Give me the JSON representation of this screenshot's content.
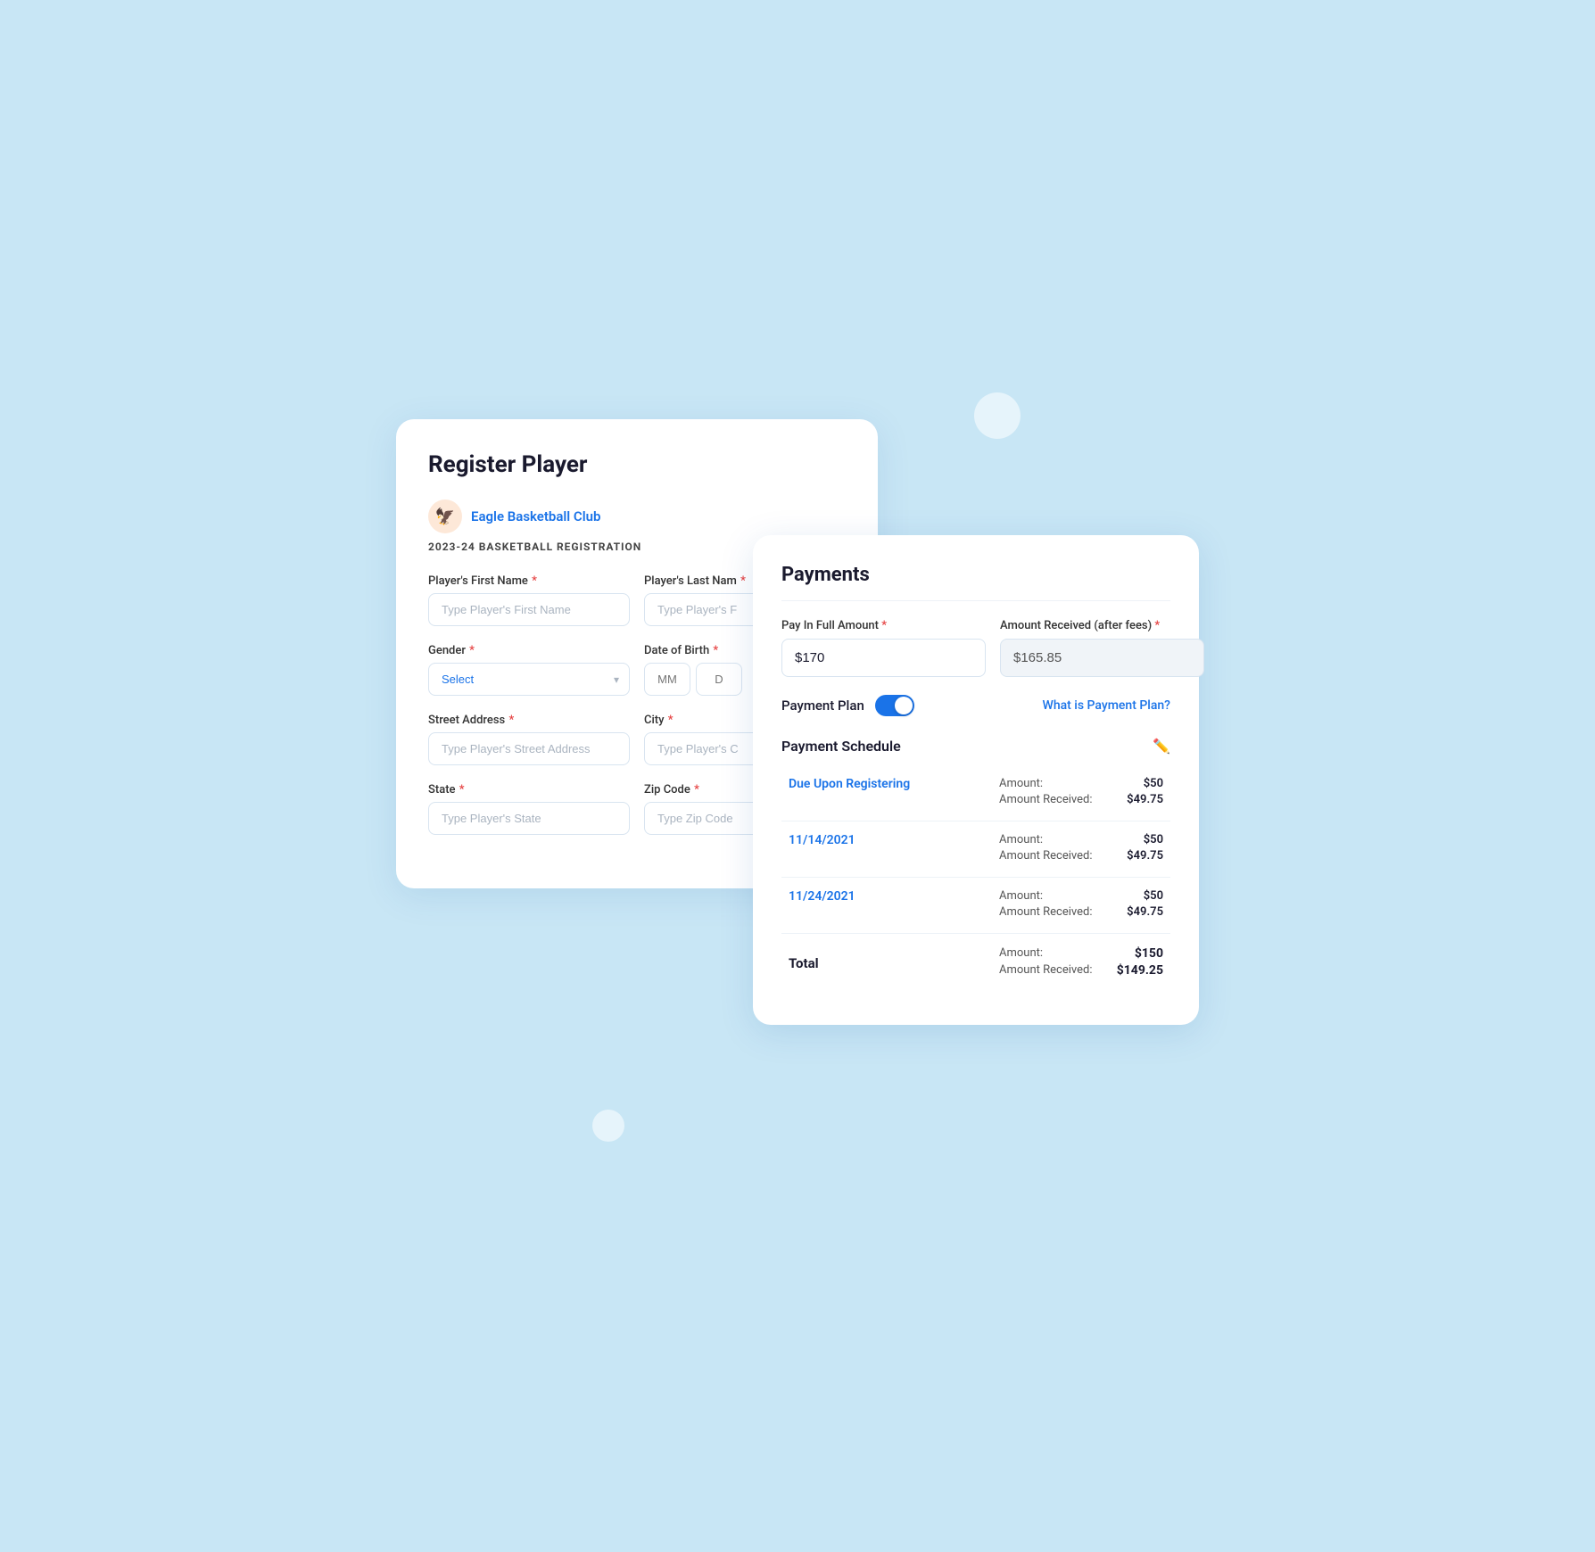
{
  "page": {
    "bg_color": "#c8e6f5"
  },
  "register_card": {
    "title": "Register Player",
    "club": {
      "name": "Eagle Basketball Club",
      "logo_emoji": "🦅"
    },
    "season": "2023-24 BASKETBALL REGISTRATION",
    "fields": {
      "first_name_label": "Player's First Name",
      "first_name_placeholder": "Type Player's First Name",
      "last_name_label": "Player's Last Nam",
      "last_name_placeholder": "Type Player's F",
      "gender_label": "Gender",
      "gender_placeholder": "Select",
      "dob_label": "Date of Birth",
      "dob_mm": "MM",
      "dob_dd": "D",
      "street_label": "Street Address",
      "street_placeholder": "Type Player's Street Address",
      "city_label": "City",
      "city_placeholder": "Type Player's C",
      "state_label": "State",
      "state_placeholder": "Type Player's State",
      "zip_label": "Zip Code",
      "zip_placeholder": "Type Zip Code"
    }
  },
  "payments_card": {
    "title": "Payments",
    "pay_in_full_label": "Pay In Full Amount",
    "pay_in_full_value": "$170",
    "amount_received_label": "Amount Received (after fees)",
    "amount_received_value": "$165.85",
    "payment_plan_label": "Payment Plan",
    "payment_plan_link": "What is Payment Plan?",
    "schedule_title": "Payment Schedule",
    "schedule_rows": [
      {
        "date": "Due Upon Registering",
        "amount": "$50",
        "amount_received": "$49.75"
      },
      {
        "date": "11/14/2021",
        "amount": "$50",
        "amount_received": "$49.75"
      },
      {
        "date": "11/24/2021",
        "amount": "$50",
        "amount_received": "$49.75"
      }
    ],
    "total": {
      "label": "Total",
      "amount": "$150",
      "amount_received": "$149.25"
    },
    "labels": {
      "amount": "Amount:",
      "amount_received": "Amount Received:"
    }
  }
}
